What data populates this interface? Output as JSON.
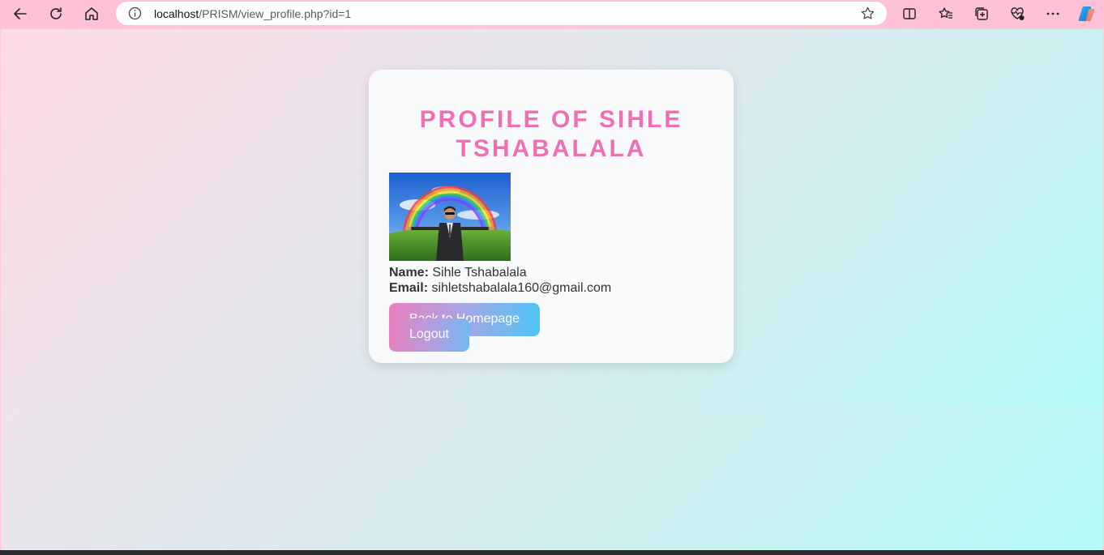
{
  "browser": {
    "url_host": "localhost",
    "url_path": "/PRISM/view_profile.php?id=1",
    "icons": [
      "back-icon",
      "refresh-icon",
      "home-icon",
      "info-icon",
      "favorite-star-icon",
      "split-screen-icon",
      "favorites-icon",
      "collections-icon",
      "browser-essentials-icon",
      "more-icon",
      "copilot-icon"
    ]
  },
  "profile": {
    "title": "PROFILE OF SIHLE TSHABALALA",
    "photo_alt": "Profile photo",
    "name_label": "Name:",
    "name_value": "Sihle Tshabalala",
    "email_label": "Email:",
    "email_value": "sihletshabalala160@gmail.com"
  },
  "actions": {
    "home_label": "Back to Homepage",
    "logout_label": "Logout"
  },
  "colors": {
    "title": "#f06eb4",
    "button_start": "#ea7fc0",
    "button_end": "#4fc5f7"
  }
}
